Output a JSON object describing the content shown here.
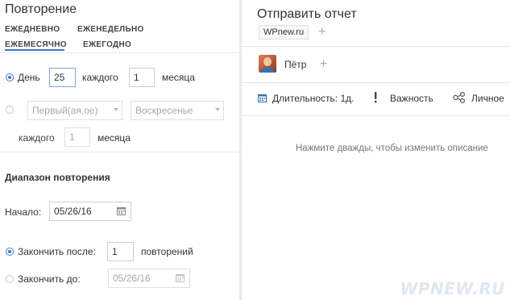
{
  "repeat": {
    "title": "Повторение",
    "frequencies": [
      "ЕЖЕДНЕВНО",
      "ЕЖЕНЕДЕЛЬНО",
      "ЕЖЕМЕСЯЧНО",
      "ЕЖЕГОДНО"
    ],
    "active_frequency": "ЕЖЕМЕСЯЧНО",
    "option_day": {
      "label": "День",
      "day_value": "25",
      "every_label": "каждого",
      "every_value": "1",
      "unit_label": "месяца",
      "selected": true
    },
    "option_weekday": {
      "ordinal_placeholder": "Первый(ая,ое)",
      "weekday_placeholder": "Воскресенье",
      "every_label": "каждого",
      "every_value": "1",
      "unit_label": "месяца",
      "selected": false
    }
  },
  "range": {
    "title": "Диапазон повторения",
    "start_label": "Начало:",
    "start_value": "05/26/16",
    "end_after": {
      "label": "Закончить после:",
      "value": "1",
      "unit": "повторений",
      "selected": true
    },
    "end_by": {
      "label": "Закончить до:",
      "value": "05/26/16",
      "selected": false
    }
  },
  "task": {
    "title": "Отправить отчет",
    "tag": "WPnew.ru",
    "assignee": "Пётр",
    "duration": "Длительность: 1д.",
    "importance": "Важность",
    "personal": "Личное",
    "description_hint": "Нажмите дважды, чтобы изменить описание"
  },
  "watermark": "WPNEW.RU",
  "colors": {
    "accent": "#3b79c4",
    "divider": "#e9e9e9"
  },
  "icons": [
    "calendar-icon",
    "exclamation-icon",
    "share-icon",
    "plus-icon"
  ]
}
